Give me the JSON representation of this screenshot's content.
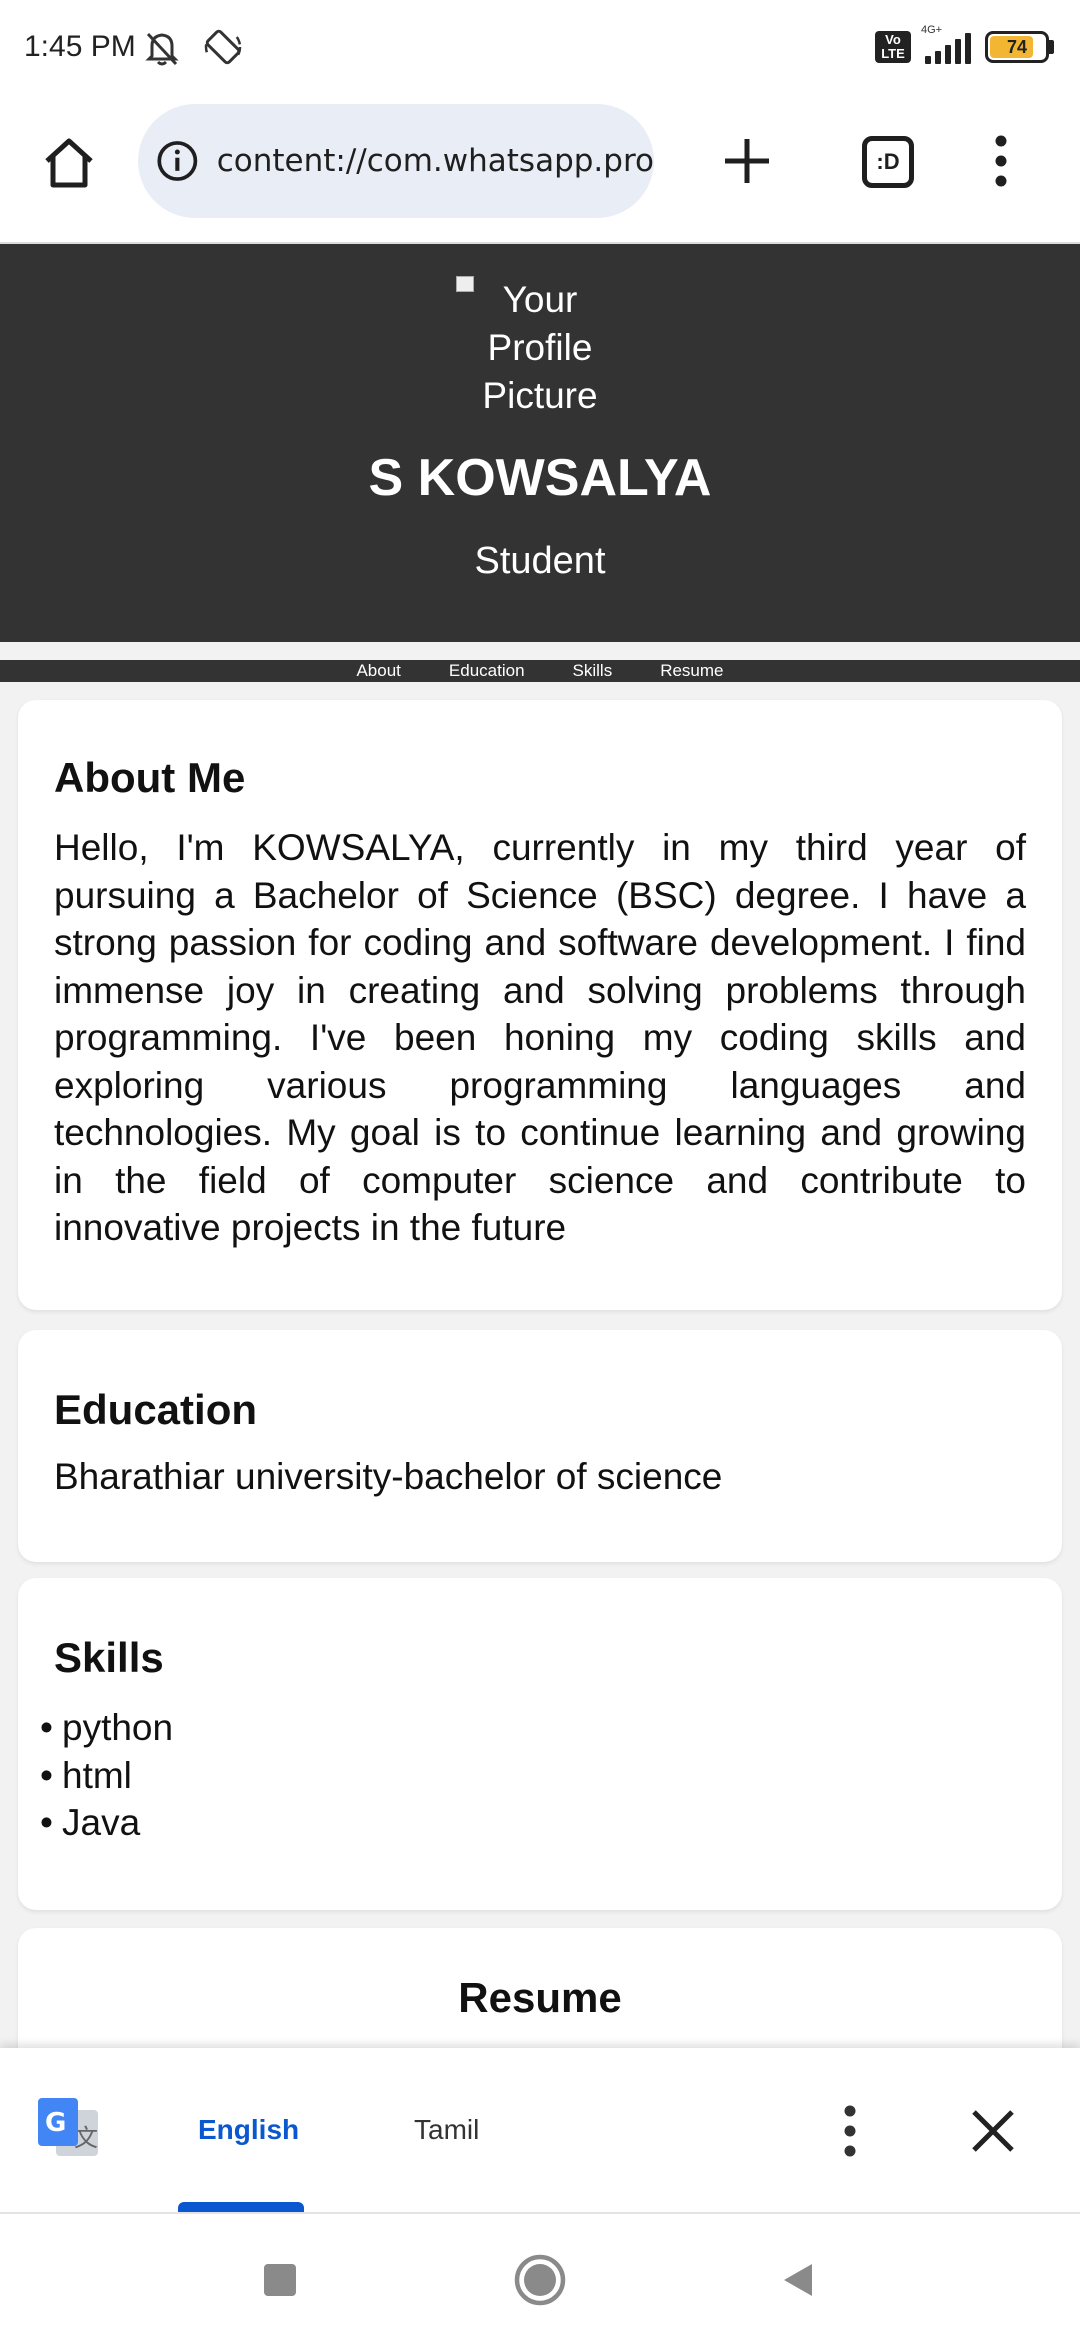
{
  "status_bar": {
    "time": "1:45 PM",
    "network": "4G+",
    "volte": "Vo LTE",
    "battery": "74",
    "battery_level_percent": 74
  },
  "browser": {
    "url": "content://com.whatsapp.pro",
    "tabs_label": ":D",
    "icons": [
      "home-icon",
      "info-icon",
      "plus-icon",
      "tab-switcher-icon",
      "more-vert-icon"
    ]
  },
  "profile": {
    "picture_alt": "Your Profile Picture",
    "name": "S KOWSALYA",
    "role": "Student"
  },
  "nav": {
    "about": "About",
    "education": "Education",
    "skills": "Skills",
    "resume": "Resume"
  },
  "about": {
    "title": "About Me",
    "text": "Hello, I'm KOWSALYA, currently in my third year of pursuing a Bachelor of Science (BSC) degree. I have a strong passion for coding and software development. I find immense joy in creating and solving problems through programming. I've been honing my coding skills and exploring various programming languages and technologies. My goal is to continue learning and growing in the field of computer science and contribute to innovative projects in the future"
  },
  "education": {
    "title": "Education",
    "text": "Bharathiar university-bachelor of science"
  },
  "skills": {
    "title": "Skills",
    "items": [
      "python",
      "html",
      "Java"
    ]
  },
  "resume": {
    "title": "Resume"
  },
  "translate": {
    "lang_primary": "English",
    "lang_secondary": "Tamil"
  },
  "colors": {
    "header_bg": "#333333",
    "accent": "#0b57d0",
    "url_bar_bg": "#e9eef6"
  }
}
